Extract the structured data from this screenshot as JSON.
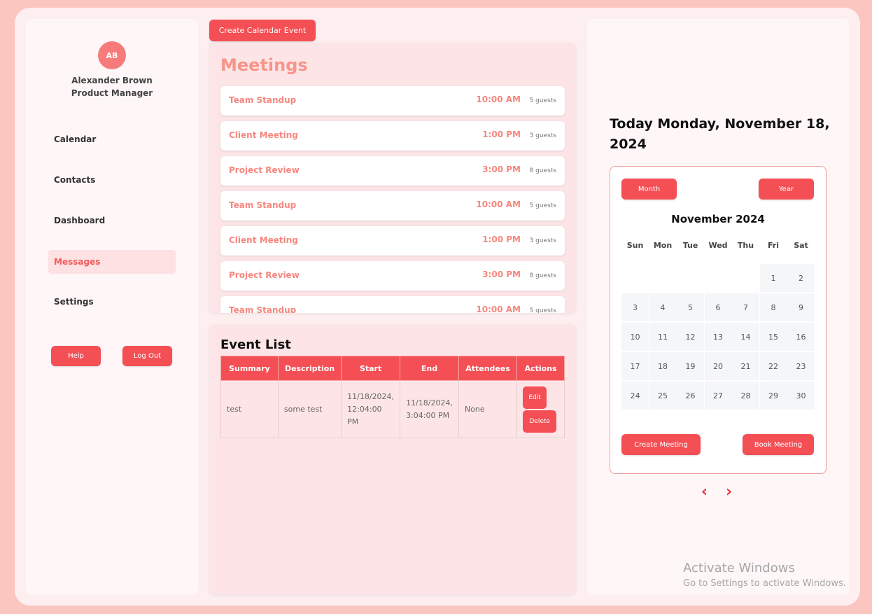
{
  "user": {
    "initials": "AB",
    "name": "Alexander Brown",
    "role": "Product Manager"
  },
  "nav": [
    {
      "label": "Calendar"
    },
    {
      "label": "Contacts"
    },
    {
      "label": "Dashboard"
    },
    {
      "label": "Messages",
      "active": true
    },
    {
      "label": "Settings"
    }
  ],
  "sidebar_buttons": {
    "help": "Help",
    "logout": "Log Out"
  },
  "create_event_label": "Create Calendar Event",
  "meetings": {
    "title": "Meetings",
    "items": [
      {
        "name": "Team Standup",
        "time": "10:00 AM",
        "guests": "5 guests"
      },
      {
        "name": "Client Meeting",
        "time": "1:00 PM",
        "guests": "3 guests"
      },
      {
        "name": "Project Review",
        "time": "3:00 PM",
        "guests": "8 guests"
      },
      {
        "name": "Team Standup",
        "time": "10:00 AM",
        "guests": "5 guests"
      },
      {
        "name": "Client Meeting",
        "time": "1:00 PM",
        "guests": "3 guests"
      },
      {
        "name": "Project Review",
        "time": "3:00 PM",
        "guests": "8 guests"
      },
      {
        "name": "Team Standup",
        "time": "10:00 AM",
        "guests": "5 guests"
      }
    ]
  },
  "event_list": {
    "title": "Event List",
    "headers": [
      "Summary",
      "Description",
      "Start",
      "End",
      "Attendees",
      "Actions"
    ],
    "rows": [
      {
        "summary": "test",
        "description": "some test",
        "start": "11/18/2024, 12:04:00 PM",
        "end": "11/18/2024, 3:04:00 PM",
        "attendees": "None"
      }
    ],
    "edit_label": "Edit",
    "delete_label": "Delete"
  },
  "today_label": "Today Monday, November 18, 2024",
  "calendar": {
    "month_button": "Month",
    "year_button": "Year",
    "month_title": "November 2024",
    "weekdays": [
      "Sun",
      "Mon",
      "Tue",
      "Wed",
      "Thu",
      "Fri",
      "Sat"
    ],
    "first_weekday_index": 5,
    "days": [
      "1",
      "2",
      "3",
      "4",
      "5",
      "6",
      "7",
      "8",
      "9",
      "10",
      "11",
      "12",
      "13",
      "14",
      "15",
      "16",
      "17",
      "18",
      "19",
      "20",
      "21",
      "22",
      "23",
      "24",
      "25",
      "26",
      "27",
      "28",
      "29",
      "30"
    ],
    "create_meeting": "Create Meeting",
    "book_meeting": "Book Meeting",
    "prev_icon": "‹",
    "next_icon": "›"
  },
  "watermark": {
    "line1": "Activate Windows",
    "line2": "Go to Settings to activate Windows."
  }
}
